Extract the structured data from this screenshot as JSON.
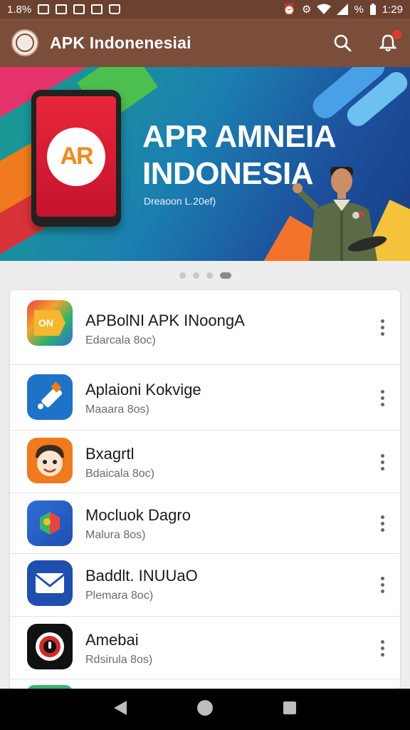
{
  "status_bar": {
    "left_text": "1.8%",
    "battery_text": "%",
    "time": "1:29"
  },
  "app_bar": {
    "title": "APK Indonenesiai"
  },
  "banner": {
    "title_line1": "APR AMNEIA",
    "title_line2": "INDONESIA",
    "subtitle": "Dreaoon L.20ef)",
    "phone_logo_text": "AR"
  },
  "carousel": {
    "count": 4,
    "active_index": 3
  },
  "apps": [
    {
      "title": "APBolNI APK INoongA",
      "subtitle": "Edarcala 8oc)",
      "icon": "on-logo-icon",
      "icon_text": "ON"
    },
    {
      "title": "Aplaioni Kokvige",
      "subtitle": "Maaara 8os)",
      "icon": "brush-icon",
      "icon_text": ""
    },
    {
      "title": "Bxagrtl",
      "subtitle": "Bdaicala 8oc)",
      "icon": "cartoon-face-icon",
      "icon_text": ""
    },
    {
      "title": "Mocluok Dagro",
      "subtitle": "Malura 8os)",
      "icon": "map-pin-icon",
      "icon_text": ""
    },
    {
      "title": "Baddlt. INUUaO",
      "subtitle": "Plemara 8oc)",
      "icon": "mail-icon",
      "icon_text": ""
    },
    {
      "title": "Amebai",
      "subtitle": "Rdsirula 8os)",
      "icon": "record-icon",
      "icon_text": ""
    }
  ],
  "colors": {
    "status_bar": "#6b4130",
    "app_bar": "#7a4e3a",
    "nav_bar": "#000000"
  }
}
